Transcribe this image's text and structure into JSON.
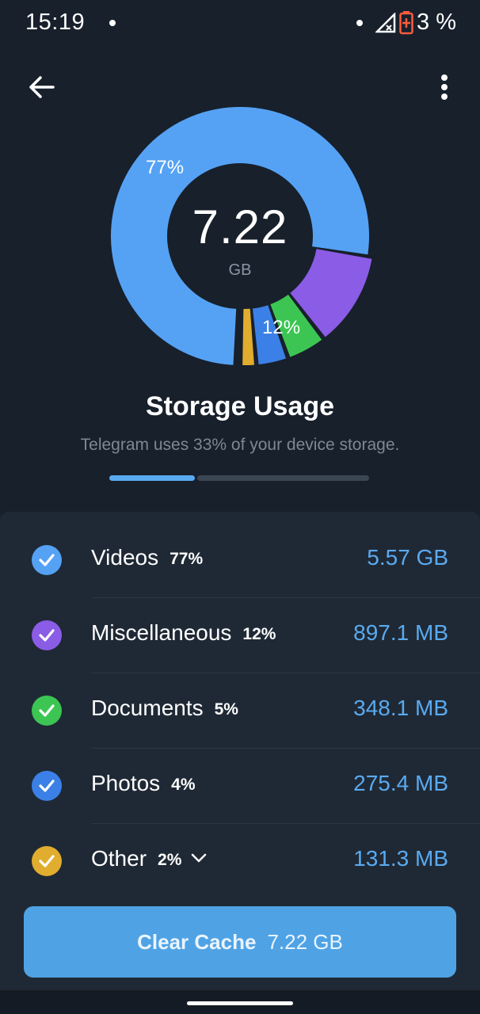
{
  "status_bar": {
    "time": "15:19",
    "battery": "3 %"
  },
  "header": {
    "back_icon": "arrow-left-icon",
    "menu_icon": "more-vertical-icon"
  },
  "colors": {
    "background": "#18202b",
    "panel": "#1f2935",
    "accent": "#5aaaf0",
    "videos": "#55a2f5",
    "miscellaneous": "#8b5ce6",
    "documents": "#3cc553",
    "photos": "#3b80e6",
    "other": "#e0ad2e"
  },
  "chart_data": {
    "type": "pie",
    "categories": [
      "Videos",
      "Miscellaneous",
      "Documents",
      "Photos",
      "Other"
    ],
    "values": [
      77,
      12,
      5,
      4,
      2
    ],
    "labels_shown": [
      "77%",
      "12%"
    ],
    "center_value": "7.22",
    "center_unit": "GB"
  },
  "storage": {
    "title": "Storage Usage",
    "subtitle": "Telegram uses 33% of your device storage.",
    "device_usage_fraction": 0.33
  },
  "items": [
    {
      "name": "Videos",
      "percent": "77%",
      "size": "5.57 GB",
      "color": "#55a2f5",
      "checked": true
    },
    {
      "name": "Miscellaneous",
      "percent": "12%",
      "size": "897.1 MB",
      "color": "#8b5ce6",
      "checked": true
    },
    {
      "name": "Documents",
      "percent": "5%",
      "size": "348.1 MB",
      "color": "#3cc553",
      "checked": true
    },
    {
      "name": "Photos",
      "percent": "4%",
      "size": "275.4 MB",
      "color": "#3b80e6",
      "checked": true
    },
    {
      "name": "Other",
      "percent": "2%",
      "size": "131.3 MB",
      "color": "#e0ad2e",
      "checked": true,
      "expandable": true
    }
  ],
  "clear_button": {
    "label": "Clear Cache",
    "amount": "7.22 GB"
  }
}
